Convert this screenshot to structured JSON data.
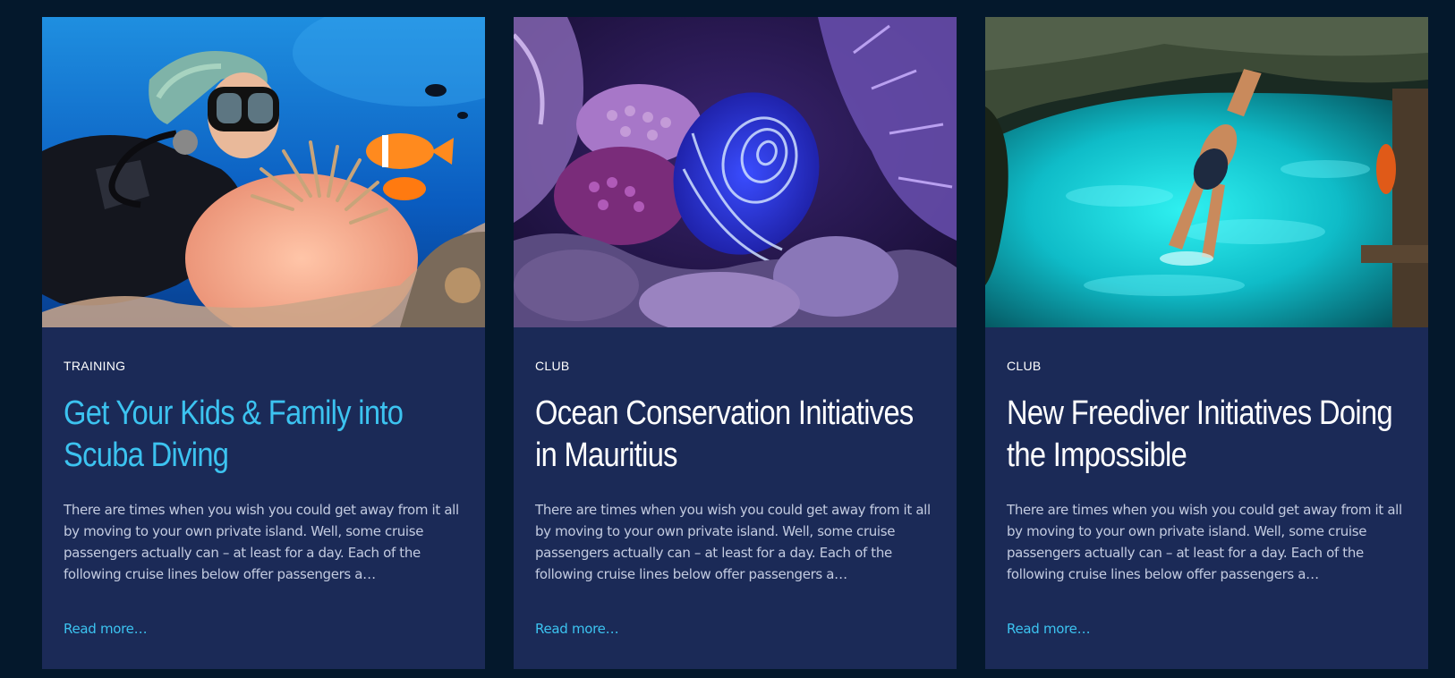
{
  "colors": {
    "page_background": "#04182c",
    "card_background": "#1b2a57",
    "accent": "#3cc3f0",
    "title": "#ffffff",
    "excerpt": "#c3cbe0"
  },
  "cards": [
    {
      "image": "scuba-diver-with-anemone-and-clownfish-photo",
      "category": "TRAINING",
      "title": "Get Your Kids & Family into Scuba Diving",
      "excerpt": "There are times when you wish you could get away from it all by moving to your own private island. Well, some cruise passengers actually can – at least for a day. Each of the following cruise lines below offer passengers a…",
      "read_more": "Read more…"
    },
    {
      "image": "angelfish-on-coral-reef-photo",
      "category": "CLUB",
      "title": "Ocean Conservation Initiatives in Mauritius",
      "excerpt": "There are times when you wish you could get away from it all by moving to your own private island. Well, some cruise passengers actually can – at least for a day. Each of the following cruise lines below offer passengers a…",
      "read_more": "Read more…"
    },
    {
      "image": "freediver-diving-into-cenote-photo",
      "category": "CLUB",
      "title": "New Freediver Initiatives Doing the Impossible",
      "excerpt": "There are times when you wish you could get away from it all by moving to your own private island. Well, some cruise passengers actually can – at least for a day. Each of the following cruise lines below offer passengers a…",
      "read_more": "Read more…"
    }
  ]
}
